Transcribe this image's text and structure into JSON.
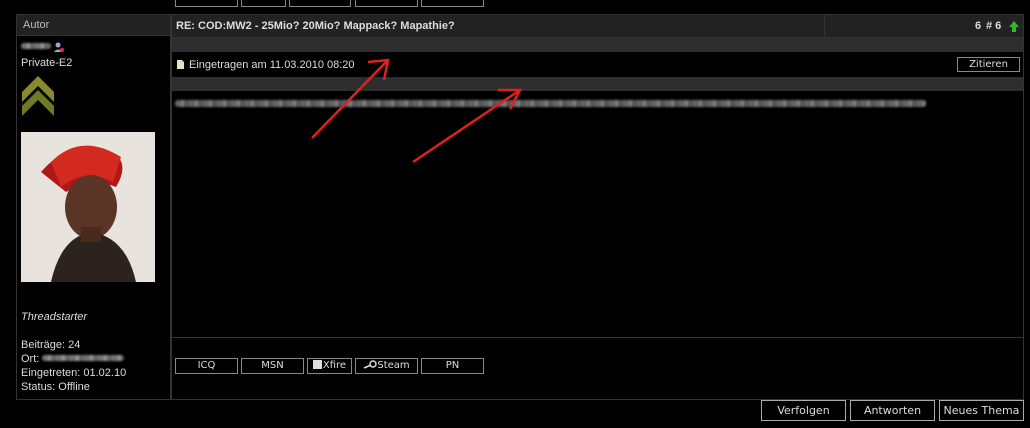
{
  "sidebar": {
    "header_label": "Autor",
    "rank": "Private-E2",
    "role": "Threadstarter",
    "posts": "Beiträge: 24",
    "location_label": "Ort:",
    "joined": "Eingetreten: 01.02.10",
    "status": "Status: Offline"
  },
  "post": {
    "title": "RE: COD:MW2 - 25Mio? 20Mio? Mappack? Mapathie?",
    "number_count": "6",
    "number_label": "# 6",
    "posted_at": "Eingetragen am 11.03.2010 08:20",
    "quote_label": "Zitieren"
  },
  "contact_buttons": {
    "icq": "ICQ",
    "msn": "MSN",
    "xfire": "Xfire",
    "steam": "Steam",
    "pn": "PN"
  },
  "actions": {
    "follow": "Verfolgen",
    "reply": "Antworten",
    "new_thread": "Neues Thema"
  },
  "colors": {
    "header_bg": "#222222",
    "divider": "#2e2e2e",
    "accent_arrow": "#e02020",
    "up_arrow": "#2db82d"
  }
}
